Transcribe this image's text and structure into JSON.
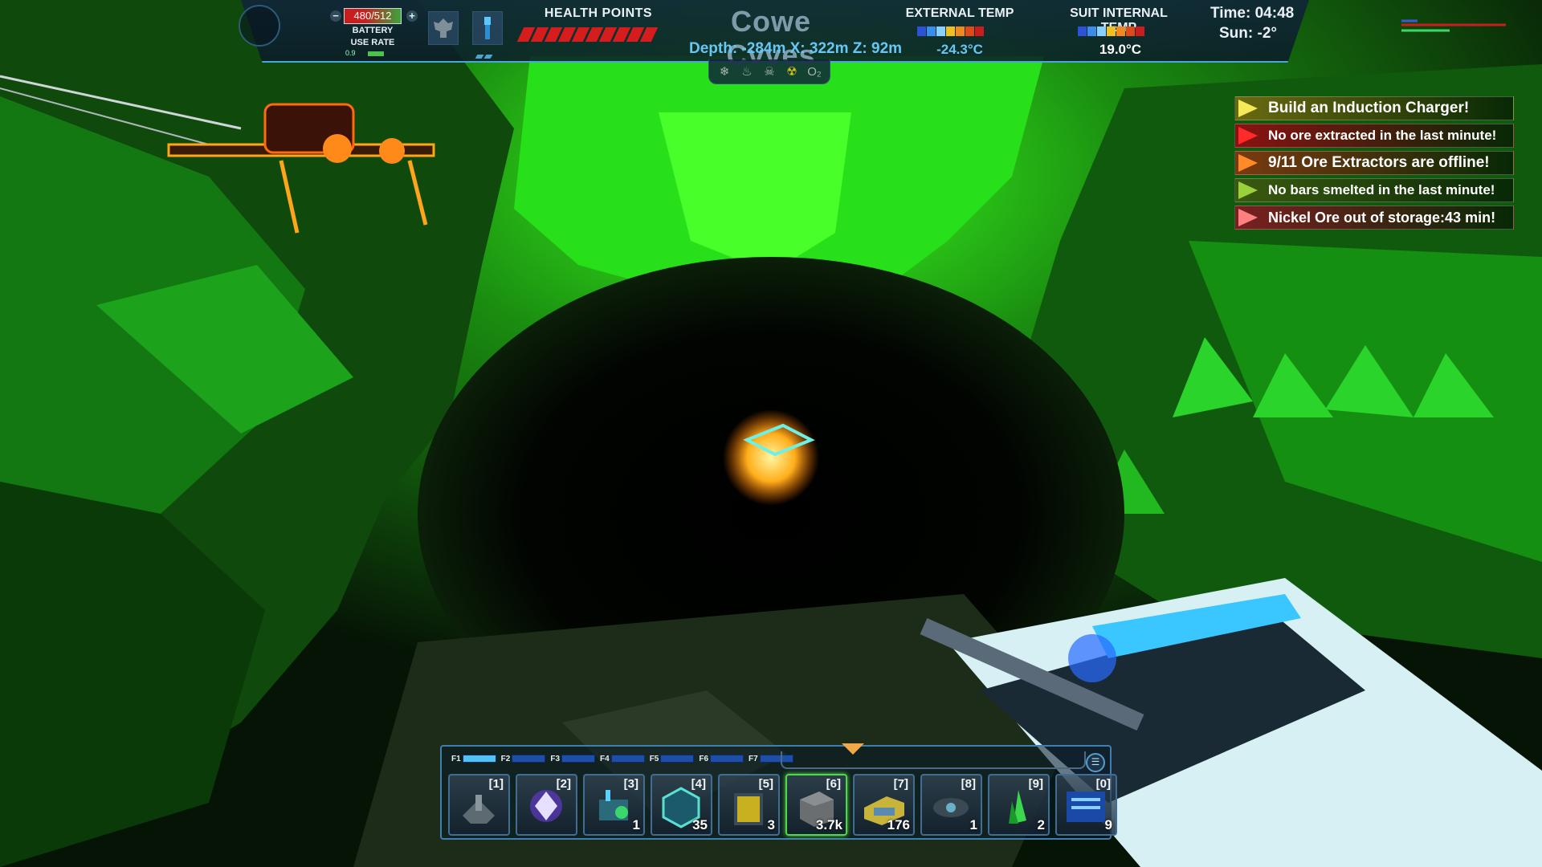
{
  "hud": {
    "battery": {
      "charge": "480/512",
      "label_line1": "BATTERY",
      "label_line2": "USE RATE",
      "use_rate": "0.9"
    },
    "health": {
      "label": "HEALTH POINTS",
      "segments_filled": 10,
      "segments_total": 10
    },
    "location": {
      "name": "Cowe Cvves",
      "coords": "Depth: -284m  X: 322m  Z: 92m"
    },
    "external_temp": {
      "label": "EXTERNAL TEMP",
      "value": "-24.3°C"
    },
    "internal_temp": {
      "label": "SUIT INTERNAL TEMP",
      "value": "19.0°C"
    },
    "time": "Time: 04:48",
    "sun": "Sun: -2°",
    "colors": {
      "accent": "#4aa6d8",
      "health": "#d51d1d",
      "coords": "#66c7f5"
    }
  },
  "notifications": [
    {
      "text": "Build an Induction Charger!",
      "bg": "#6b6a10",
      "arrow": "#f5e85a",
      "size": "19px"
    },
    {
      "text": "No ore extracted in the last minute!",
      "bg": "#8a1212",
      "arrow": "#ff2a2a",
      "size": "17px"
    },
    {
      "text": "9/11 Ore Extractors are offline!",
      "bg": "#7a3a10",
      "arrow": "#ff8a2a",
      "size": "19px"
    },
    {
      "text": "No bars smelted in the last minute!",
      "bg": "#3a5a10",
      "arrow": "#9ad03a",
      "size": "17px"
    },
    {
      "text": "Nickel Ore out of storage:43 min!",
      "bg": "#7a2020",
      "arrow": "#ff8080",
      "size": "18px"
    }
  ],
  "hotbar": {
    "fkeys": [
      "F1",
      "F2",
      "F3",
      "F4",
      "F5",
      "F6",
      "F7"
    ],
    "active_fkey": 0,
    "slots": [
      {
        "key": "[1]",
        "qty": "",
        "icon": "drill-rig-icon"
      },
      {
        "key": "[2]",
        "qty": "",
        "icon": "crystal-icon"
      },
      {
        "key": "[3]",
        "qty": "1",
        "icon": "conveyor-machine-icon"
      },
      {
        "key": "[4]",
        "qty": "35",
        "icon": "cargo-pod-icon"
      },
      {
        "key": "[5]",
        "qty": "3",
        "icon": "storage-crate-icon"
      },
      {
        "key": "[6]",
        "qty": "3.7k",
        "icon": "rock-block-icon",
        "selected": true
      },
      {
        "key": "[7]",
        "qty": "176",
        "icon": "container-icon"
      },
      {
        "key": "[8]",
        "qty": "1",
        "icon": "drone-icon"
      },
      {
        "key": "[9]",
        "qty": "2",
        "icon": "green-crystal-icon"
      },
      {
        "key": "[0]",
        "qty": "9",
        "icon": "circuit-panel-icon"
      }
    ]
  }
}
